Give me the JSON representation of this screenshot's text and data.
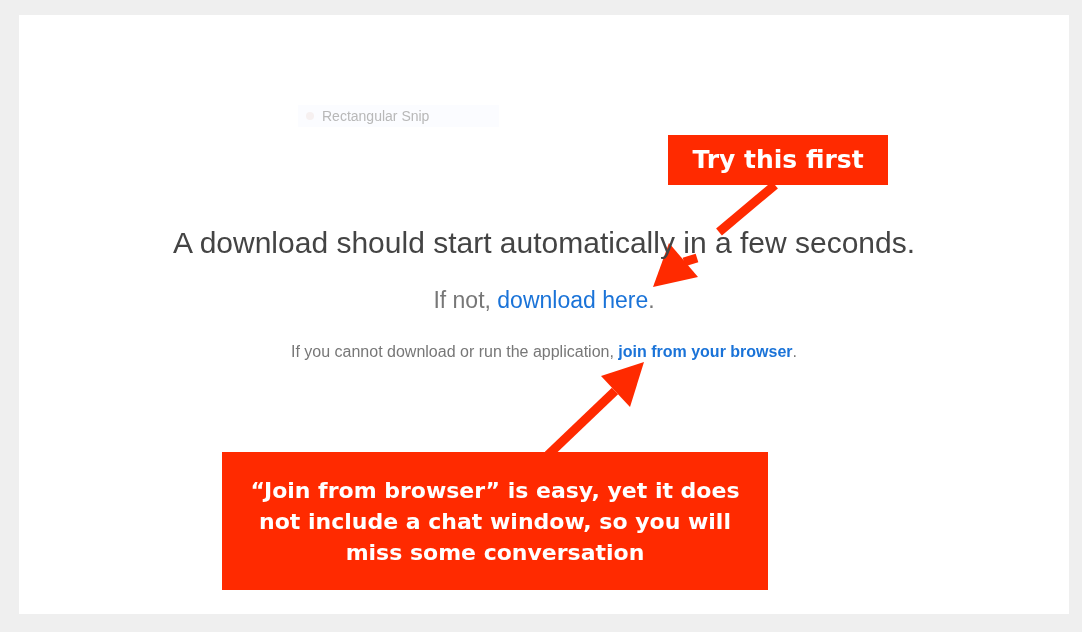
{
  "snip_tool": {
    "label": "Rectangular Snip"
  },
  "headline": "A download should start automatically in a few seconds.",
  "fallback": {
    "prefix": "If not, ",
    "link": "download here",
    "suffix": "."
  },
  "browser_note": {
    "prefix": "If you cannot download or run the application, ",
    "link": "join from your browser",
    "suffix": "."
  },
  "callouts": [
    {
      "kind": "top",
      "text": "Try this first"
    },
    {
      "kind": "bottom",
      "text": "“Join from browser” is easy, yet it does not include a chat window, so you will miss some conversation"
    }
  ]
}
